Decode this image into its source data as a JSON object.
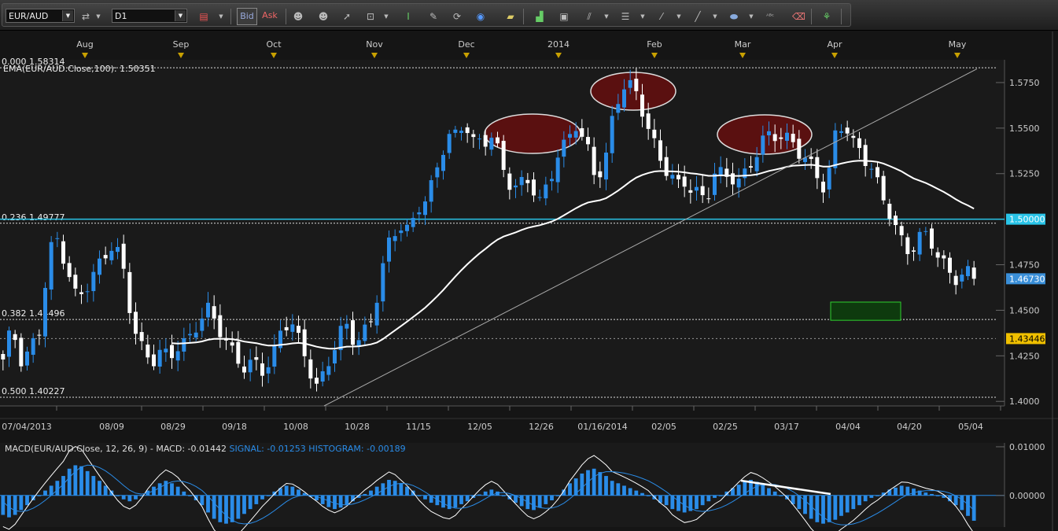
{
  "toolbar": {
    "symbol": "EUR/AUD",
    "timeframe": "D1",
    "bid_label": "Bid",
    "ask_label": "Ask",
    "dropdown_glyph": "▼",
    "tools": [
      "swap-icon",
      "crosshair-icon",
      "person-icon",
      "pointer-icon",
      "zoom-icon",
      "text-icon",
      "edit-icon",
      "refresh-icon",
      "globe-icon",
      "ruler-icon",
      "chart-icon",
      "window-icon",
      "fib-icon",
      "menu-icon",
      "pen-icon",
      "line-icon",
      "ellipse-icon",
      "abc-icon",
      "eraser-icon",
      "tree-icon"
    ]
  },
  "chart_data": {
    "type": "candlestick",
    "title": "",
    "ylim": [
      1.3975,
      1.5875
    ],
    "y_ticks": [
      "1.5750",
      "1.5500",
      "1.5250",
      "1.5000",
      "1.4750",
      "1.4500",
      "1.4250",
      "1.4000"
    ],
    "x_ticks": [
      "07/04/2013",
      "08/09",
      "08/29",
      "09/18",
      "10/08",
      "10/28",
      "11/15",
      "12/05",
      "12/26",
      "01/16/2014",
      "02/05",
      "02/25",
      "03/17",
      "04/04",
      "04/20",
      "05/04"
    ],
    "month_labels": [
      "Aug",
      "Sep",
      "Oct",
      "Nov",
      "Dec",
      "2014",
      "Feb",
      "Mar",
      "Apr",
      "May"
    ],
    "fib_levels": [
      {
        "label": "0.000 1.58314",
        "value": 1.58314
      },
      {
        "label": "0.236 1.49777",
        "value": 1.49777
      },
      {
        "label": "0.382 1.44496",
        "value": 1.44496
      },
      {
        "label": "0.500 1.40227",
        "value": 1.40227
      }
    ],
    "ema_label": "EMA(EUR/AUD.Close,100): 1.50351",
    "ema_value": 1.50351,
    "price_tags": [
      {
        "text": "1.50000",
        "value": 1.5,
        "color": "#29c4e8"
      },
      {
        "text": "1.46730",
        "value": 1.4673,
        "color": "#3a8fd8"
      },
      {
        "text": "1.43446",
        "value": 1.43446,
        "color": "#f0c000"
      }
    ],
    "horizontal_line": 1.5,
    "dotted_line": 1.4345,
    "last_close": 1.4673,
    "macd": {
      "label": "MACD(EUR/AUD.Close, 12, 26, 9) -",
      "macd_text": "MACD: -0.01442",
      "signal_text": "SIGNAL: -0.01253",
      "hist_text": "HISTOGRAM: -0.00189",
      "y_ticks": [
        "0.01000",
        "0.00000"
      ],
      "ylim": [
        -0.0065,
        0.0108
      ],
      "histogram": [
        -0.004,
        -0.0045,
        -0.004,
        -0.003,
        -0.002,
        -0.001,
        0.0,
        0.001,
        0.002,
        0.003,
        0.004,
        0.0055,
        0.0062,
        0.006,
        0.005,
        0.004,
        0.003,
        0.002,
        0.001,
        0.0,
        -0.0008,
        -0.0012,
        -0.0008,
        0.0,
        0.001,
        0.0018,
        0.0025,
        0.003,
        0.0025,
        0.0018,
        0.0008,
        0.0,
        -0.001,
        -0.002,
        -0.0035,
        -0.0048,
        -0.0055,
        -0.0058,
        -0.0055,
        -0.0048,
        -0.0038,
        -0.0028,
        -0.0018,
        -0.0008,
        0.0,
        0.0008,
        0.0015,
        0.002,
        0.0018,
        0.0012,
        0.0005,
        -0.0003,
        -0.001,
        -0.0018,
        -0.0024,
        -0.0028,
        -0.0025,
        -0.002,
        -0.0012,
        -0.0005,
        0.0003,
        0.001,
        0.0018,
        0.0025,
        0.0032,
        0.003,
        0.0024,
        0.0018,
        0.001,
        0.0,
        -0.0008,
        -0.0015,
        -0.002,
        -0.0025,
        -0.0028,
        -0.0025,
        -0.0018,
        -0.0012,
        -0.0005,
        0.0002,
        0.0008,
        0.0012,
        0.0008,
        0.0,
        -0.0008,
        -0.0015,
        -0.0022,
        -0.0028,
        -0.003,
        -0.0025,
        -0.0018,
        -0.001,
        0.0,
        0.0012,
        0.0025,
        0.0035,
        0.0045,
        0.0052,
        0.0055,
        0.0048,
        0.004,
        0.003,
        0.0025,
        0.002,
        0.0015,
        0.001,
        0.0005,
        0.0,
        -0.0008,
        -0.0015,
        -0.002,
        -0.0028,
        -0.0032,
        -0.0035,
        -0.0032,
        -0.0028,
        -0.002,
        -0.0012,
        -0.0005,
        0.0,
        0.0008,
        0.0015,
        0.0022,
        0.0028,
        0.0032,
        0.0028,
        0.0022,
        0.0015,
        0.0008,
        0.0,
        -0.0008,
        -0.0018,
        -0.0028,
        -0.0038,
        -0.0048,
        -0.0055,
        -0.0058,
        -0.0055,
        -0.005,
        -0.0042,
        -0.0035,
        -0.0028,
        -0.002,
        -0.0012,
        -0.0005,
        0.0,
        0.0006,
        0.0012,
        0.0016,
        0.002,
        0.0018,
        0.0014,
        0.001,
        0.0006,
        0.0003,
        0.0,
        -0.0005,
        -0.0012,
        -0.002,
        -0.003,
        -0.0042,
        -0.0052,
        -0.0058,
        -0.005,
        -0.004,
        -0.003,
        -0.002,
        -0.0015
      ]
    }
  }
}
